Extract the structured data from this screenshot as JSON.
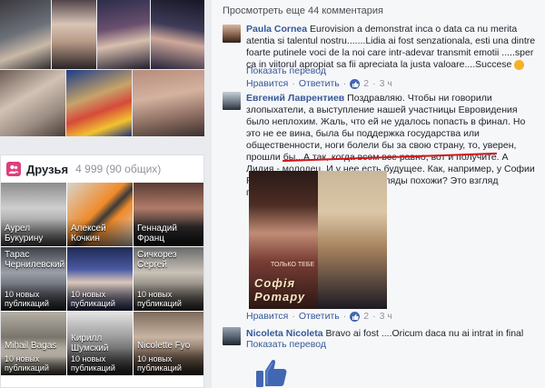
{
  "left": {
    "photos": [
      {
        "name": "photo-1"
      },
      {
        "name": "photo-2"
      },
      {
        "name": "photo-3"
      },
      {
        "name": "photo-4"
      },
      {
        "name": "photo-5"
      },
      {
        "name": "photo-6"
      },
      {
        "name": "photo-7"
      },
      {
        "name": "photo-8"
      }
    ],
    "friends": {
      "title": "Друзья",
      "count": "4 999 (90 общих)",
      "items": [
        {
          "name": "Аурел Букурину",
          "sub": ""
        },
        {
          "name": "Алексей Кочкин",
          "sub": ""
        },
        {
          "name": "Геннадий Франц",
          "sub": ""
        },
        {
          "name": "Тарас Чернилевский",
          "sub": "10 новых публикаций"
        },
        {
          "name": "",
          "sub": "10 новых публикаций"
        },
        {
          "name": "Сичкорез Сергей",
          "sub": "10 новых публикаций"
        },
        {
          "name": "Mihail Bagas",
          "sub": "10 новых публикаций"
        },
        {
          "name": "Кирилл Шумский",
          "sub": "10 новых публикаций"
        },
        {
          "name": "Nicolette Fyo",
          "sub": "10 новых публикаций"
        }
      ]
    }
  },
  "right": {
    "more_comments": "Просмотреть еще 44 комментария",
    "comments": [
      {
        "author": "Paula Cornea",
        "text": " Eurovision a demonstrat inca o data ca nu merita atentia si talentul nostru.......Lidia ai fost senzationala, esti una dintre foarte putinele voci de la noi care intr-adevar transmit emotii .....sper ca in viitorul apropiat sa fii apreciata la justa valoare....Succese",
        "translate": "Показать перевод"
      },
      {
        "author": "Евгений Лаврентиев",
        "text": " Поздравляю. Чтобы ни говорили злопыхатели, а выступление нашей участницы Евровидения было неплохим. Жаль, что ей не удалось попасть в финал. Но это не ее вина, была бы поддержка государства или общественности, ноги болели бы за свою страну, то, уверен, прошли бы...А так, когда всем все равно, вот и получите. А Лидия - молодец. И у нее есть будущее. Как, например, у Софии Ротару. Не находите, что их взгляды похожи? Это взгляд победительницы!",
        "image_caption": "Софія Ротару",
        "image_caption_small": "ТОЛЬКО ТЕБЕ",
        "actions": {
          "like": "Нравится",
          "reply": "Ответить",
          "likes": "2",
          "time": "3 ч"
        }
      },
      {
        "author": "Nicoleta Nicoleta",
        "text": " Bravo ai fost ....Oricum daca nu ai intrat in final",
        "translate": "Показать перевод"
      }
    ],
    "first_actions": {
      "like": "Нравится",
      "reply": "Ответить",
      "likes": "2",
      "time": "3 ч"
    },
    "sep": "·"
  },
  "colors": {
    "link": "#365899",
    "meta": "#90949c",
    "accent": "#4267b2",
    "friends_icon": "#dd3f7c",
    "highlight": "#d5141b"
  }
}
